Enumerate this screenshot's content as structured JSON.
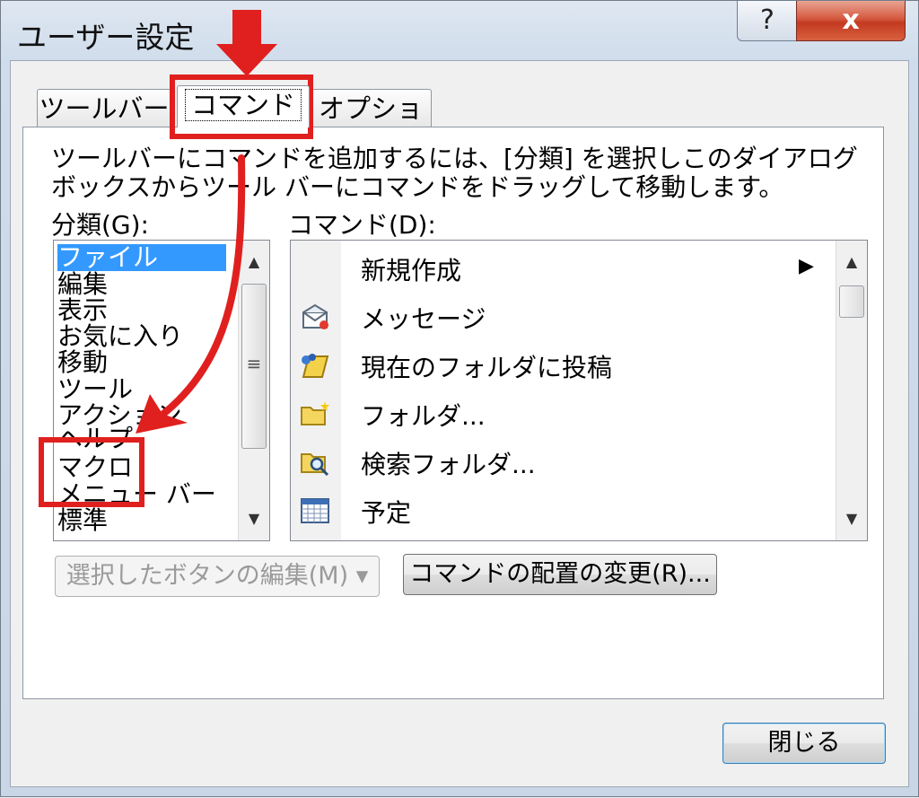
{
  "window": {
    "title": "ユーザー設定",
    "help": "?",
    "close": "x"
  },
  "tabs": [
    {
      "label": "ツールバー"
    },
    {
      "label": "コマンド"
    },
    {
      "label": "オプション"
    }
  ],
  "description": "ツールバーにコマンドを追加するには、[分類] を選択しこのダイアログ ボックスからツール バーにコマンドをドラッグして移動します。",
  "categories": {
    "label": "分類(G):",
    "items": [
      "ファイル",
      "編集",
      "表示",
      "お気に入り",
      "移動",
      "ツール",
      "アクション",
      "ヘルプ",
      "マクロ",
      "メニュー バー",
      "標準"
    ]
  },
  "commands": {
    "label": "コマンド(D):",
    "items": [
      {
        "label": "新規作成",
        "icon": "none",
        "submenu": "▶"
      },
      {
        "label": "メッセージ",
        "icon": "message-icon"
      },
      {
        "label": "現在のフォルダに投稿",
        "icon": "post-icon"
      },
      {
        "label": "フォルダ...",
        "icon": "new-folder-icon"
      },
      {
        "label": "検索フォルダ...",
        "icon": "search-folder-icon"
      },
      {
        "label": "予定",
        "icon": "calendar-icon"
      }
    ]
  },
  "buttons": {
    "edit_selection": "選択したボタンの編集(M) ▾",
    "rearrange": "コマンドの配置の変更(R)...",
    "close": "閉じる"
  },
  "colors": {
    "annotation": "#e0201e",
    "selection": "#3399ff"
  }
}
